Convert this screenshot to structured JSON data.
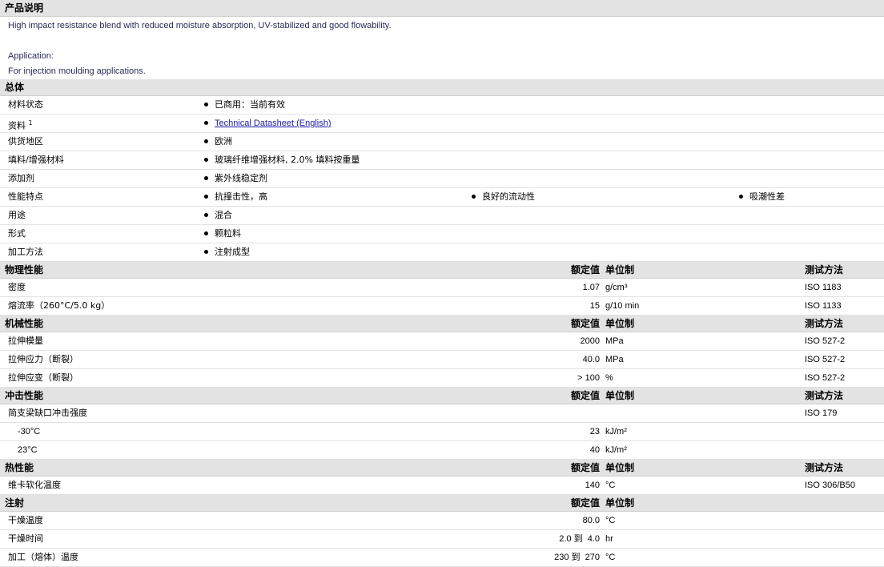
{
  "desc": {
    "title": "产品说明",
    "line1": "High impact resistance blend with reduced moisture absorption, UV-stabilized and good flowability.",
    "line2": "Application:",
    "line3": "For injection moulding applications."
  },
  "general": {
    "title": "总体",
    "rows": [
      {
        "label": "材料状态",
        "value": "已商用：当前有效"
      },
      {
        "label": "资料",
        "sup": "1",
        "link": "Technical Datasheet (English)"
      },
      {
        "label": "供货地区",
        "value": "欧洲"
      },
      {
        "label": "填料/增强材料",
        "value": "玻璃纤维增强材料, 2.0% 填料按重量"
      },
      {
        "label": "添加剂",
        "value": "紫外线稳定剂"
      },
      {
        "label": "性能特点",
        "v1": "抗撞击性，高",
        "v2": "良好的流动性",
        "v3": "吸潮性差"
      },
      {
        "label": "用途",
        "value": "混合"
      },
      {
        "label": "形式",
        "value": "颗粒料"
      },
      {
        "label": "加工方法",
        "value": "注射成型"
      }
    ]
  },
  "headers": {
    "nominal": "额定值",
    "unit": "单位制",
    "method": "测试方法"
  },
  "physical": {
    "title": "物理性能",
    "rows": [
      {
        "label": "密度",
        "value": "1.07",
        "unit": "g/cm³",
        "method": "ISO 1183"
      },
      {
        "label": "熔流率（260°C/5.0 kg）",
        "value": "15",
        "unit": "g/10 min",
        "method": "ISO 1133"
      }
    ]
  },
  "mechanical": {
    "title": "机械性能",
    "rows": [
      {
        "label": "拉伸模量",
        "value": "2000",
        "unit": "MPa",
        "method": "ISO 527-2"
      },
      {
        "label": "拉伸应力（断裂）",
        "value": "40.0",
        "unit": "MPa",
        "method": "ISO 527-2"
      },
      {
        "label": "拉伸应变（断裂）",
        "value": "> 100",
        "unit": "%",
        "method": "ISO 527-2"
      }
    ]
  },
  "impact": {
    "title": "冲击性能",
    "rows": [
      {
        "label": "简支梁缺口冲击强度",
        "value": "",
        "unit": "",
        "method": "ISO 179"
      },
      {
        "label": "-30°C",
        "value": "23",
        "unit": "kJ/m²",
        "method": ""
      },
      {
        "label": "23°C",
        "value": "40",
        "unit": "kJ/m²",
        "method": ""
      }
    ]
  },
  "thermal": {
    "title": "热性能",
    "rows": [
      {
        "label": "维卡软化温度",
        "value": "140",
        "unit": "°C",
        "method": "ISO 306/B50"
      }
    ]
  },
  "injection": {
    "title": "注射",
    "rows": [
      {
        "label": "干燥温度",
        "value": "80.0",
        "unit": "°C"
      },
      {
        "label": "干燥时间",
        "value": "2.0 到  4.0",
        "unit": "hr"
      },
      {
        "label": "加工（熔体）温度",
        "value": "230 到  270",
        "unit": "°C"
      }
    ]
  }
}
